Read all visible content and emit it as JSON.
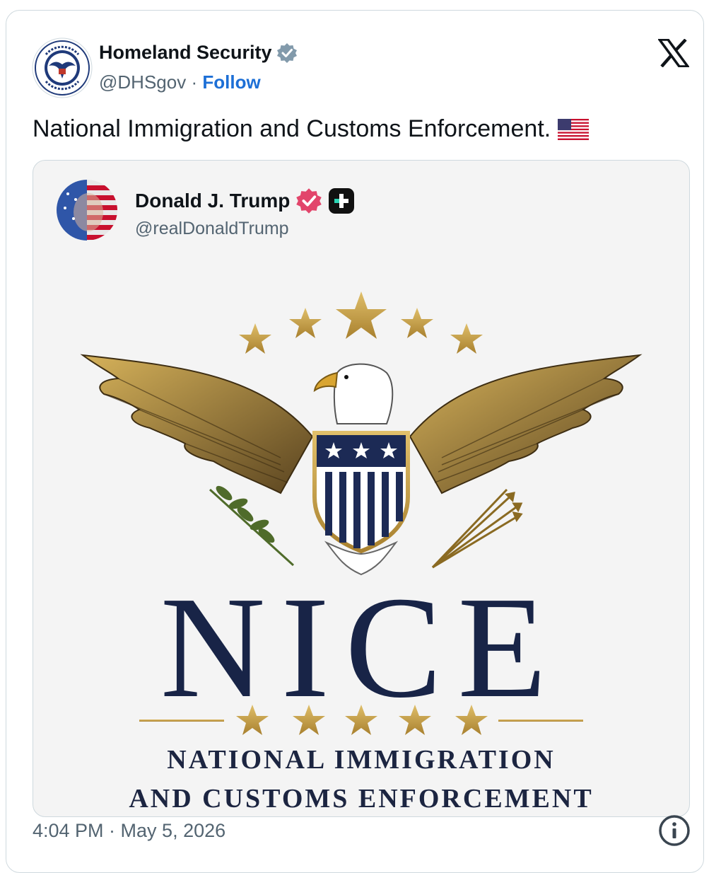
{
  "author": {
    "name": "Homeland Security",
    "handle": "@DHSgov",
    "separator": "·",
    "follow_label": "Follow"
  },
  "post": {
    "text": "National Immigration and Customs Enforcement.",
    "emoji": "us-flag"
  },
  "quoted": {
    "name": "Donald J. Trump",
    "handle": "@realDonaldTrump",
    "image": {
      "headline": "NICE",
      "tagline_line1": "NATIONAL IMMIGRATION",
      "tagline_line2": "AND CUSTOMS ENFORCEMENT"
    }
  },
  "meta": {
    "timestamp": "4:04 PM · May 5, 2026"
  },
  "icons": [
    "dhs-seal-icon",
    "verified-badge-icon",
    "x-logo-icon",
    "us-flag-icon",
    "pink-verified-icon",
    "plus-badge-icon",
    "info-icon"
  ],
  "colors": {
    "follow_blue": "#1d6fd6",
    "navy": "#182447",
    "gold": "#c9a13a",
    "muted_text": "#536471"
  }
}
